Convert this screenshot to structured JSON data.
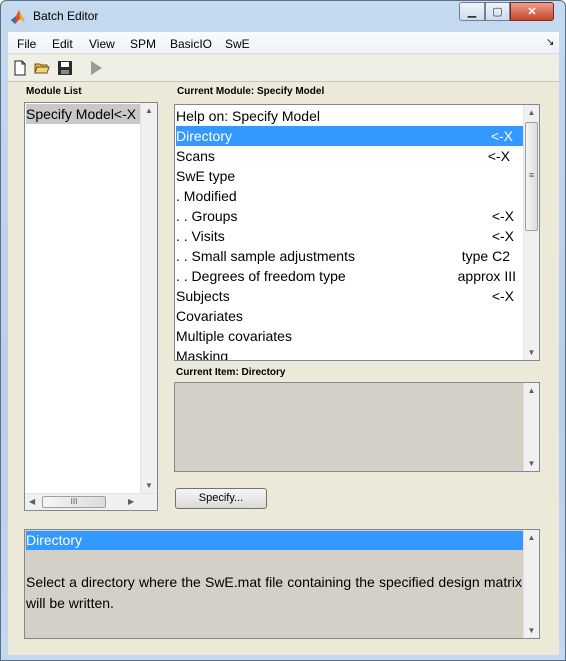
{
  "window": {
    "title": "Batch Editor",
    "min_glyph": "▁",
    "max_glyph": "▢",
    "close_glyph": "✕"
  },
  "menubar": {
    "items": [
      "File",
      "Edit",
      "View",
      "SPM",
      "BasicIO",
      "SwE"
    ],
    "dock_glyph": "↘"
  },
  "toolbar": {
    "icons": [
      "new-file-icon",
      "open-folder-icon",
      "save-icon",
      "run-icon"
    ]
  },
  "module_list": {
    "label": "Module List",
    "items": [
      "Specify Model<-X"
    ],
    "hscroll_thumb_glyph": "III"
  },
  "current_module": {
    "label": "Current Module: Specify Model",
    "rows": [
      {
        "name": "Help on: Specify Model",
        "value": ""
      },
      {
        "name": "Directory",
        "value": "<-X"
      },
      {
        "name": "Scans",
        "value": "<-X"
      },
      {
        "name": "SwE type",
        "value": ""
      },
      {
        "name": " . Modified",
        "value": ""
      },
      {
        "name": " . . Groups",
        "value": "<-X"
      },
      {
        "name": " . . Visits",
        "value": "<-X"
      },
      {
        "name": " . . Small sample adjustments",
        "value": "type C2"
      },
      {
        "name": " . . Degrees of freedom type",
        "value": "approx III"
      },
      {
        "name": "Subjects",
        "value": "<-X"
      },
      {
        "name": "Covariates",
        "value": ""
      },
      {
        "name": "Multiple covariates",
        "value": ""
      },
      {
        "name": "Masking",
        "value": ""
      }
    ],
    "selected_index": 1,
    "scroll_thumb_glyph": "≡"
  },
  "current_item": {
    "label": "Current Item: Directory"
  },
  "specify_button": {
    "label": "Specify..."
  },
  "help_panel": {
    "title": "Directory",
    "text": "Select a directory where the SwE.mat file containing the specified design matrix will be written."
  },
  "colors": {
    "selection": "#3399ff",
    "window_bg": "#ece9d8",
    "readonly_bg": "#d4d0c8"
  }
}
